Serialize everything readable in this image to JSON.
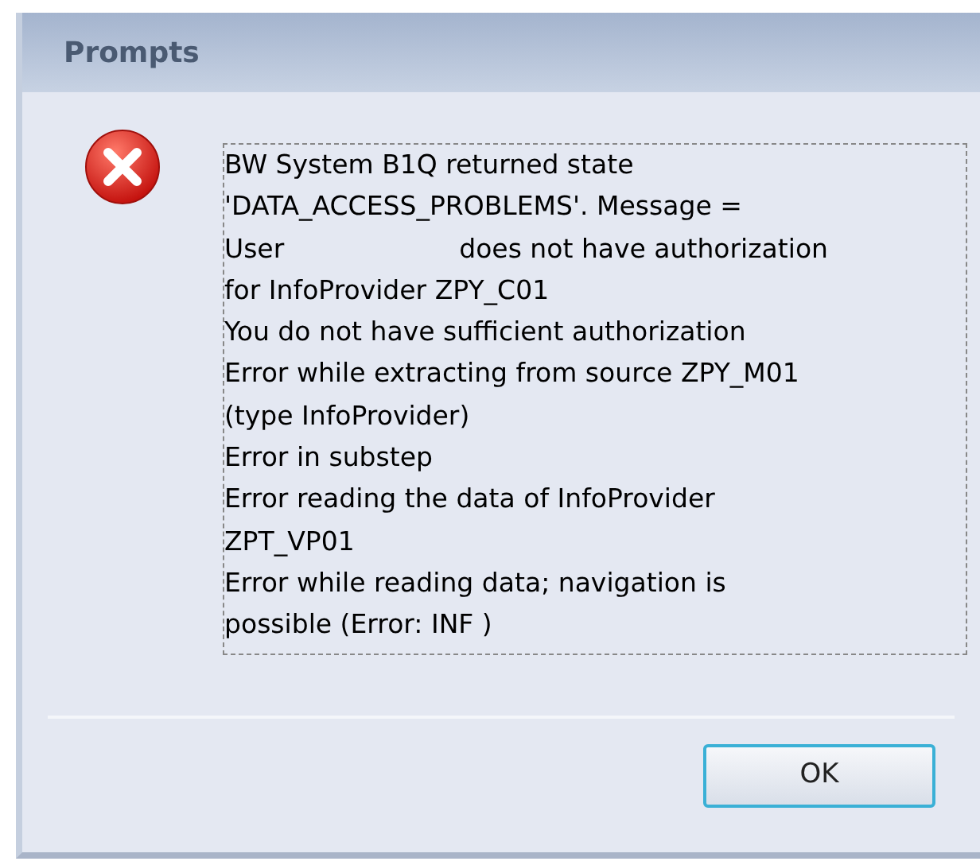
{
  "window": {
    "title": "Prompts"
  },
  "message": {
    "lines": [
      [
        "BW System B1Q returned state"
      ],
      [
        "'DATA_ACCESS_PROBLEMS'. Message ="
      ],
      [
        "User",
        "does not have authorization"
      ],
      [
        "for InfoProvider ZPY_C01"
      ],
      [
        "You do not have sufficient authorization"
      ],
      [
        "Error while extracting from source ZPY_M01"
      ],
      [
        "(type InfoProvider)"
      ],
      [
        "Error in substep"
      ],
      [
        "Error reading the data of InfoProvider"
      ],
      [
        "ZPT_VP01"
      ],
      [
        "Error while reading data; navigation is"
      ],
      [
        "possible (Error: INF )"
      ]
    ]
  },
  "buttons": [
    "OK"
  ]
}
